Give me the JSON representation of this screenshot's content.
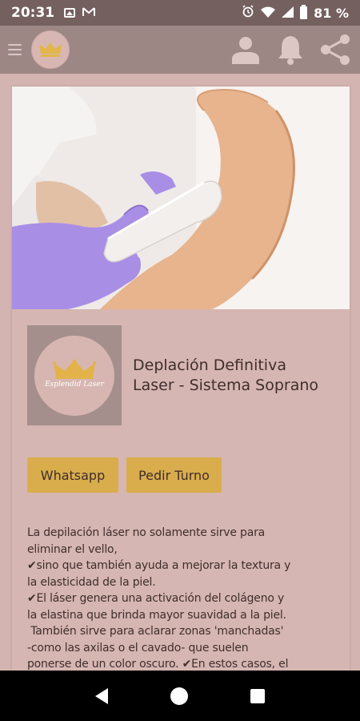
{
  "status_bar": {
    "time": "20:31",
    "battery": "81 %"
  },
  "app_bar": {
    "icons": [
      "menu-icon",
      "crown-logo",
      "person-icon",
      "bell-icon",
      "share-icon"
    ]
  },
  "service": {
    "logo_text": "Esplendid Laser",
    "title_line1": "Deplación Definitiva",
    "title_line2": "Laser - Sistema Soprano"
  },
  "buttons": {
    "whatsapp": "Whatsapp",
    "turno": "Pedir Turno"
  },
  "description": "La depilación láser no solamente sirve para\neliminar el vello,\n✔sino que también ayuda a mejorar la textura y\nla elasticidad de la piel.\n✔El láser genera una activación del colágeno y\nla elastina que brinda mayor suavidad a la piel.\n También sirve para aclarar zonas 'manchadas'\n-como las axilas o el cavado- que suelen\nponerse de un color oscuro. ✔En estos casos, el",
  "colors": {
    "status_bar": "#74605f",
    "app_bar": "#9d8785",
    "background": "#d4b4b0",
    "button": "#d9ad4c",
    "text": "#3f2e2d"
  }
}
